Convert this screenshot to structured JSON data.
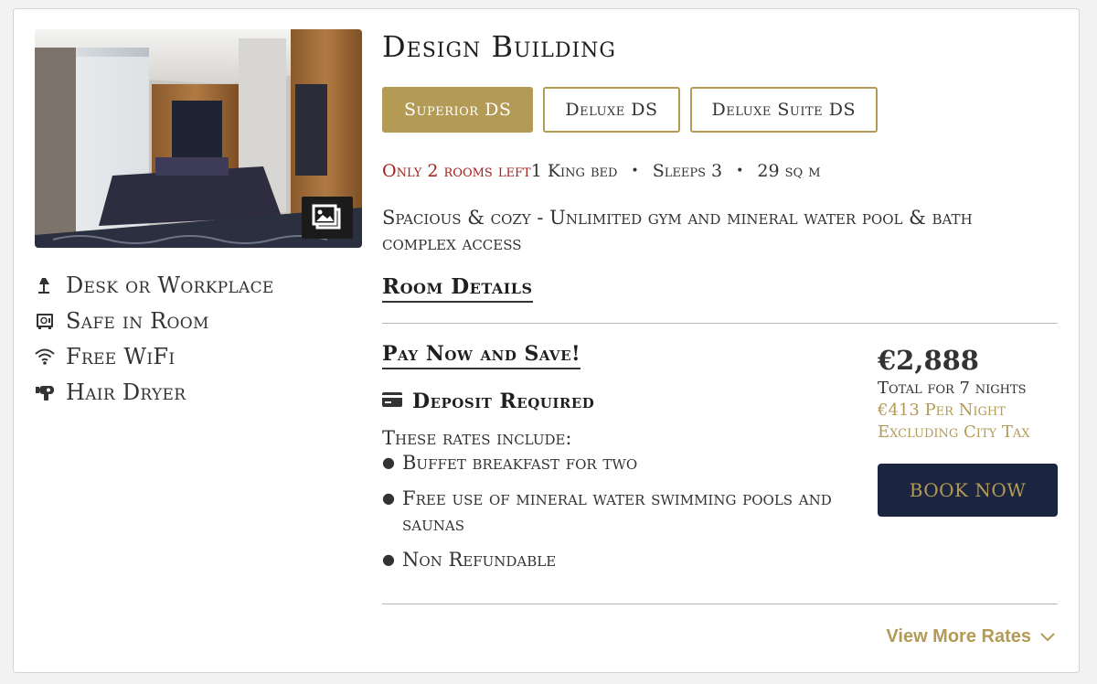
{
  "building": {
    "title": "Design Building"
  },
  "room_tabs": [
    {
      "label": "Superior DS",
      "active": true
    },
    {
      "label": "Deluxe DS",
      "active": false
    },
    {
      "label": "Deluxe Suite DS",
      "active": false
    }
  ],
  "gallery": {
    "icon": "image-gallery-icon"
  },
  "amenities": [
    {
      "icon": "desk-lamp-icon",
      "label": "Desk or Workplace"
    },
    {
      "icon": "safe-icon",
      "label": "Safe in Room"
    },
    {
      "icon": "wifi-icon",
      "label": "Free WiFi"
    },
    {
      "icon": "hair-dryer-icon",
      "label": "Hair Dryer"
    }
  ],
  "room_meta": {
    "availability": "Only 2 rooms left",
    "bed": "1 King bed",
    "sleeps": "Sleeps 3",
    "size": "29 sq m"
  },
  "description": "Spacious & cozy - Unlimited gym and mineral water pool & bath complex access",
  "room_details_link": "Room Details",
  "rate": {
    "heading": "Pay Now and Save!",
    "deposit_label": "Deposit Required",
    "deposit_icon": "credit-card-icon",
    "includes_label": "These rates include:",
    "includes": [
      "Buffet breakfast for two",
      "Free use of mineral water swimming pools and saunas",
      "Non Refundable"
    ],
    "price": "€2,888",
    "total_label": "Total for 7 nights",
    "per_night": "€413 Per Night",
    "city_tax": "Excluding City Tax",
    "book_label": "BOOK NOW"
  },
  "more_rates": {
    "label": "View More Rates",
    "icon": "chevron-down-icon"
  },
  "colors": {
    "accent_gold": "#b39a55",
    "navy": "#1b2540",
    "alert_red": "#a3221c",
    "text": "#333333"
  }
}
